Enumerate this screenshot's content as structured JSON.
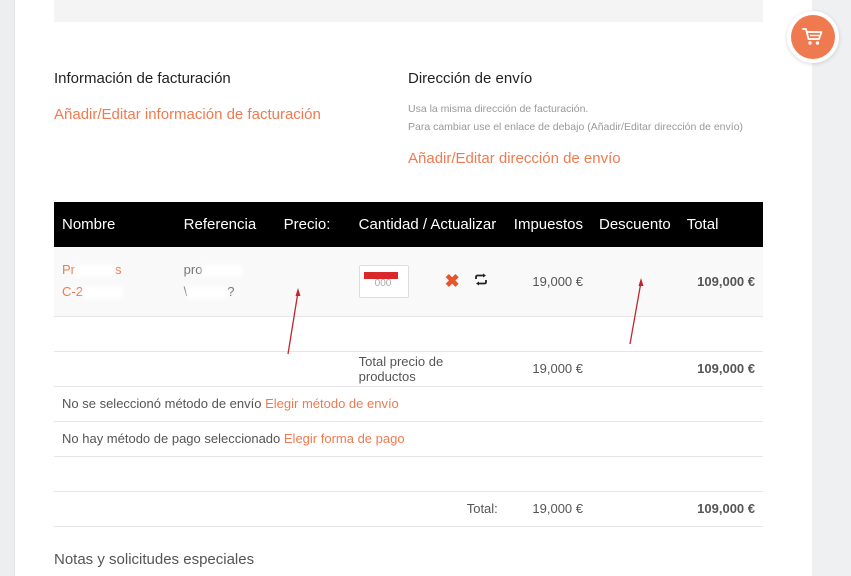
{
  "colors": {
    "accent": "#f07a50",
    "header_bg": "#000000"
  },
  "cart_button": {
    "icon": "cart-icon"
  },
  "billing": {
    "title": "Información de facturación",
    "link": "Añadir/Editar información de facturación"
  },
  "shipping": {
    "title": "Dirección de envío",
    "note_line1": "Usa la misma dirección de facturación.",
    "note_line2": "Para cambiar use el enlace de debajo (Añadir/Editar dirección de envío)",
    "link": "Añadir/Editar dirección de envío"
  },
  "table": {
    "headers": [
      "Nombre",
      "Referencia",
      "Precio:",
      "Cantidad / Actualizar",
      "Impuestos",
      "Descuento",
      "Total"
    ],
    "product": {
      "name_line1": "Pr",
      "name_line1_b": "s",
      "name_line2": "C-2",
      "ref_line1": "pro",
      "ref_line2": "\\",
      "ref_line2_b": "?",
      "qty": "000",
      "remove_icon": "close-icon",
      "update_icon": "refresh-icon",
      "tax": "19,000 €",
      "total": "109,000 €"
    },
    "subtotal": {
      "label": "Total precio de productos",
      "tax": "19,000 €",
      "total": "109,000 €"
    },
    "shipping_row": {
      "text": "No se seleccionó método de envío",
      "link": "Elegir método de envío"
    },
    "payment_row": {
      "text": "No hay método de pago seleccionado",
      "link": "Elegir forma de pago"
    },
    "grand_total": {
      "label": "Total:",
      "tax": "19,000 €",
      "total": "109,000 €"
    }
  },
  "notes": {
    "title": "Notas y solicitudes especiales"
  }
}
